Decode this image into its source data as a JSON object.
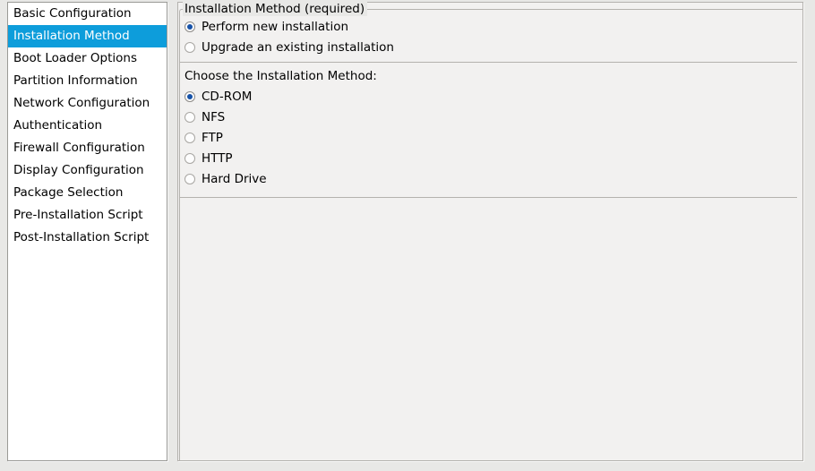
{
  "sidebar": {
    "items": [
      {
        "label": "Basic Configuration",
        "selected": false
      },
      {
        "label": "Installation Method",
        "selected": true
      },
      {
        "label": "Boot Loader Options",
        "selected": false
      },
      {
        "label": "Partition Information",
        "selected": false
      },
      {
        "label": "Network Configuration",
        "selected": false
      },
      {
        "label": "Authentication",
        "selected": false
      },
      {
        "label": "Firewall Configuration",
        "selected": false
      },
      {
        "label": "Display Configuration",
        "selected": false
      },
      {
        "label": "Package Selection",
        "selected": false
      },
      {
        "label": "Pre-Installation Script",
        "selected": false
      },
      {
        "label": "Post-Installation Script",
        "selected": false
      }
    ],
    "selection_color": "#0d9ddb"
  },
  "content": {
    "groupbox_label": "Installation Method (required)",
    "install_type": {
      "options": [
        {
          "label": "Perform new installation",
          "checked": true
        },
        {
          "label": "Upgrade an existing installation",
          "checked": false
        }
      ]
    },
    "method_caption": "Choose the Installation Method:",
    "method": {
      "options": [
        {
          "label": "CD-ROM",
          "checked": true
        },
        {
          "label": "NFS",
          "checked": false
        },
        {
          "label": "FTP",
          "checked": false
        },
        {
          "label": "HTTP",
          "checked": false
        },
        {
          "label": "Hard Drive",
          "checked": false
        }
      ]
    },
    "radio_dot_color": "#1652a8"
  }
}
